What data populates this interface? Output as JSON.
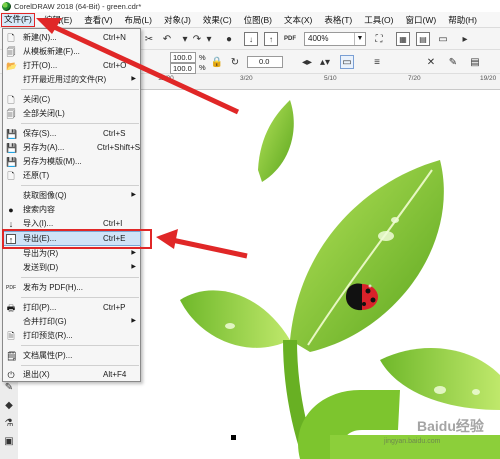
{
  "window": {
    "title": "CorelDRAW 2018 (64-Bit) - green.cdr*"
  },
  "menubar": {
    "items": [
      {
        "label": "文件(F)"
      },
      {
        "label": "编辑(E)"
      },
      {
        "label": "查看(V)"
      },
      {
        "label": "布局(L)"
      },
      {
        "label": "对象(J)"
      },
      {
        "label": "效果(C)"
      },
      {
        "label": "位图(B)"
      },
      {
        "label": "文本(X)"
      },
      {
        "label": "表格(T)"
      },
      {
        "label": "工具(O)"
      },
      {
        "label": "窗口(W)"
      },
      {
        "label": "帮助(H)"
      }
    ]
  },
  "toolbar": {
    "zoom": "400%",
    "pdf_label": "PDF",
    "width_value": "100.0",
    "height_value": "100.0",
    "percent": "%",
    "angle_value": "0.0"
  },
  "ruler": {
    "ticks": [
      "11/20",
      "3/20",
      "5/10",
      "7/20",
      "19/20"
    ]
  },
  "file_menu": {
    "items": [
      {
        "label": "新建(N)...",
        "shortcut": "Ctrl+N",
        "icon": "new-document-icon"
      },
      {
        "label": "从模板新建(F)...",
        "shortcut": "",
        "icon": "template-icon"
      },
      {
        "label": "打开(O)...",
        "shortcut": "Ctrl+O",
        "icon": "open-folder-icon"
      },
      {
        "label": "打开最近用过的文件(R)",
        "shortcut": "",
        "icon": ""
      },
      {
        "label": "关闭(C)",
        "shortcut": "",
        "icon": "close-document-icon"
      },
      {
        "label": "全部关闭(L)",
        "shortcut": "",
        "icon": "close-all-icon"
      },
      {
        "label": "保存(S)...",
        "shortcut": "Ctrl+S",
        "icon": "save-icon"
      },
      {
        "label": "另存为(A)...",
        "shortcut": "Ctrl+Shift+S",
        "icon": "save-as-icon"
      },
      {
        "label": "另存为模版(M)...",
        "shortcut": "",
        "icon": "save-template-icon"
      },
      {
        "label": "还原(T)",
        "shortcut": "",
        "icon": "revert-icon"
      },
      {
        "label": "获取图像(Q)",
        "shortcut": "",
        "icon": ""
      },
      {
        "label": "搜索内容",
        "shortcut": "",
        "icon": "search-content-icon"
      },
      {
        "label": "导入(I)...",
        "shortcut": "Ctrl+I",
        "icon": "import-icon"
      },
      {
        "label": "导出(E)...",
        "shortcut": "Ctrl+E",
        "icon": "export-icon"
      },
      {
        "label": "导出为(R)",
        "shortcut": "",
        "icon": ""
      },
      {
        "label": "发送到(D)",
        "shortcut": "",
        "icon": ""
      },
      {
        "label": "发布为 PDF(H)...",
        "shortcut": "",
        "icon": "pdf-icon"
      },
      {
        "label": "打印(P)...",
        "shortcut": "Ctrl+P",
        "icon": "print-icon"
      },
      {
        "label": "合并打印(G)",
        "shortcut": "",
        "icon": ""
      },
      {
        "label": "打印预览(R)...",
        "shortcut": "",
        "icon": "print-preview-icon"
      },
      {
        "label": "文档属性(P)...",
        "shortcut": "",
        "icon": "document-properties-icon"
      },
      {
        "label": "退出(X)",
        "shortcut": "Alt+F4",
        "icon": "exit-icon"
      }
    ]
  },
  "watermark": {
    "text": "Baidu经验",
    "url": "jingyan.baidu.com"
  },
  "colors": {
    "accent_red": "#e02727",
    "leaf_green": "#7dc52e",
    "highlight": "#cfe3f7"
  }
}
